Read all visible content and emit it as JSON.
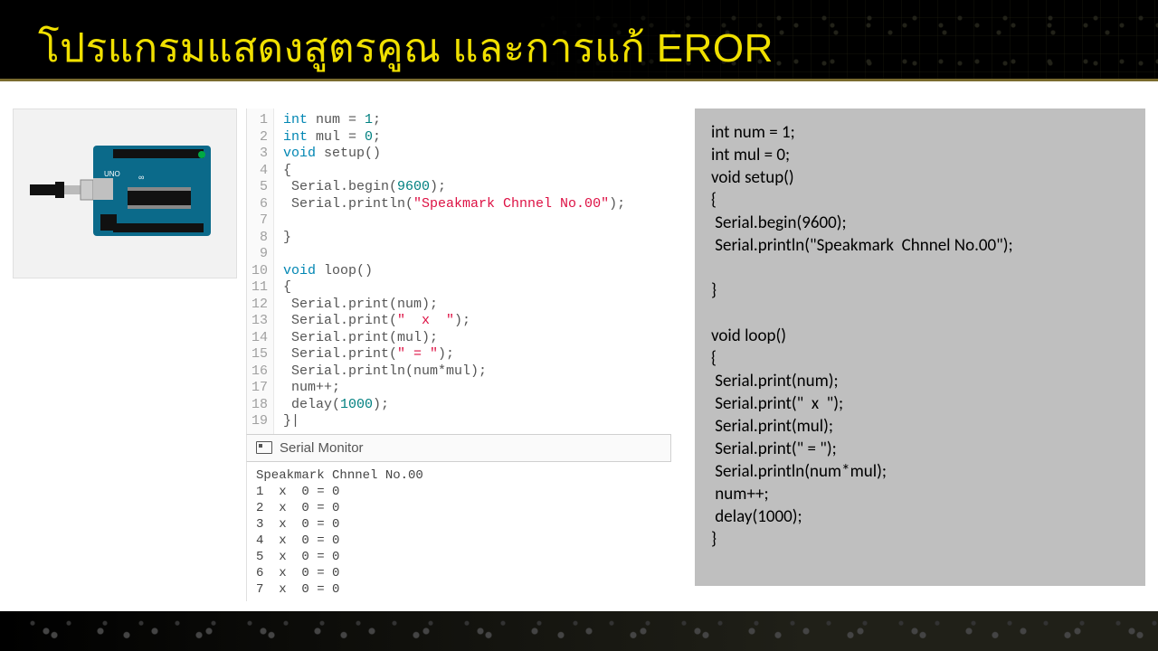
{
  "title": "โปรแกรมแสดงสูตรคูณ และการแก้ EROR",
  "editor": {
    "line_count": 19,
    "lines_html": [
      "<span class='kw'>int</span> num = <span class='num'>1</span>;",
      "<span class='kw'>int</span> mul = <span class='num'>0</span>;",
      "<span class='kw'>void</span> <span class='fn'>setup</span>()",
      "{",
      " Serial.begin(<span class='num'>9600</span>);",
      " Serial.println(<span class='str'>\"Speakmark Chnnel No.00\"</span>);",
      "",
      "}",
      "",
      "<span class='kw'>void</span> <span class='fn'>loop</span>()",
      "{",
      " Serial.print(num);",
      " Serial.print(<span class='str'>\"  x  \"</span>);",
      " Serial.print(mul);",
      " Serial.print(<span class='str'>\" = \"</span>);",
      " Serial.println(num*mul);",
      " num++;",
      " delay(<span class='num'>1000</span>);",
      "}|"
    ]
  },
  "serial_monitor": {
    "label": "Serial Monitor",
    "output": "Speakmark Chnnel No.00\n1  x  0 = 0\n2  x  0 = 0\n3  x  0 = 0\n4  x  0 = 0\n5  x  0 = 0\n6  x  0 = 0\n7  x  0 = 0"
  },
  "plain_code": "int num = 1;\nint mul = 0;\nvoid setup()\n{\n Serial.begin(9600);\n Serial.println(\"Speakmark  Chnnel No.00\");\n\n}\n\nvoid loop()\n{\n Serial.print(num);\n Serial.print(\"  x  \");\n Serial.print(mul);\n Serial.print(\" = \");\n Serial.println(num*mul);\n num++;\n delay(1000);\n}"
}
